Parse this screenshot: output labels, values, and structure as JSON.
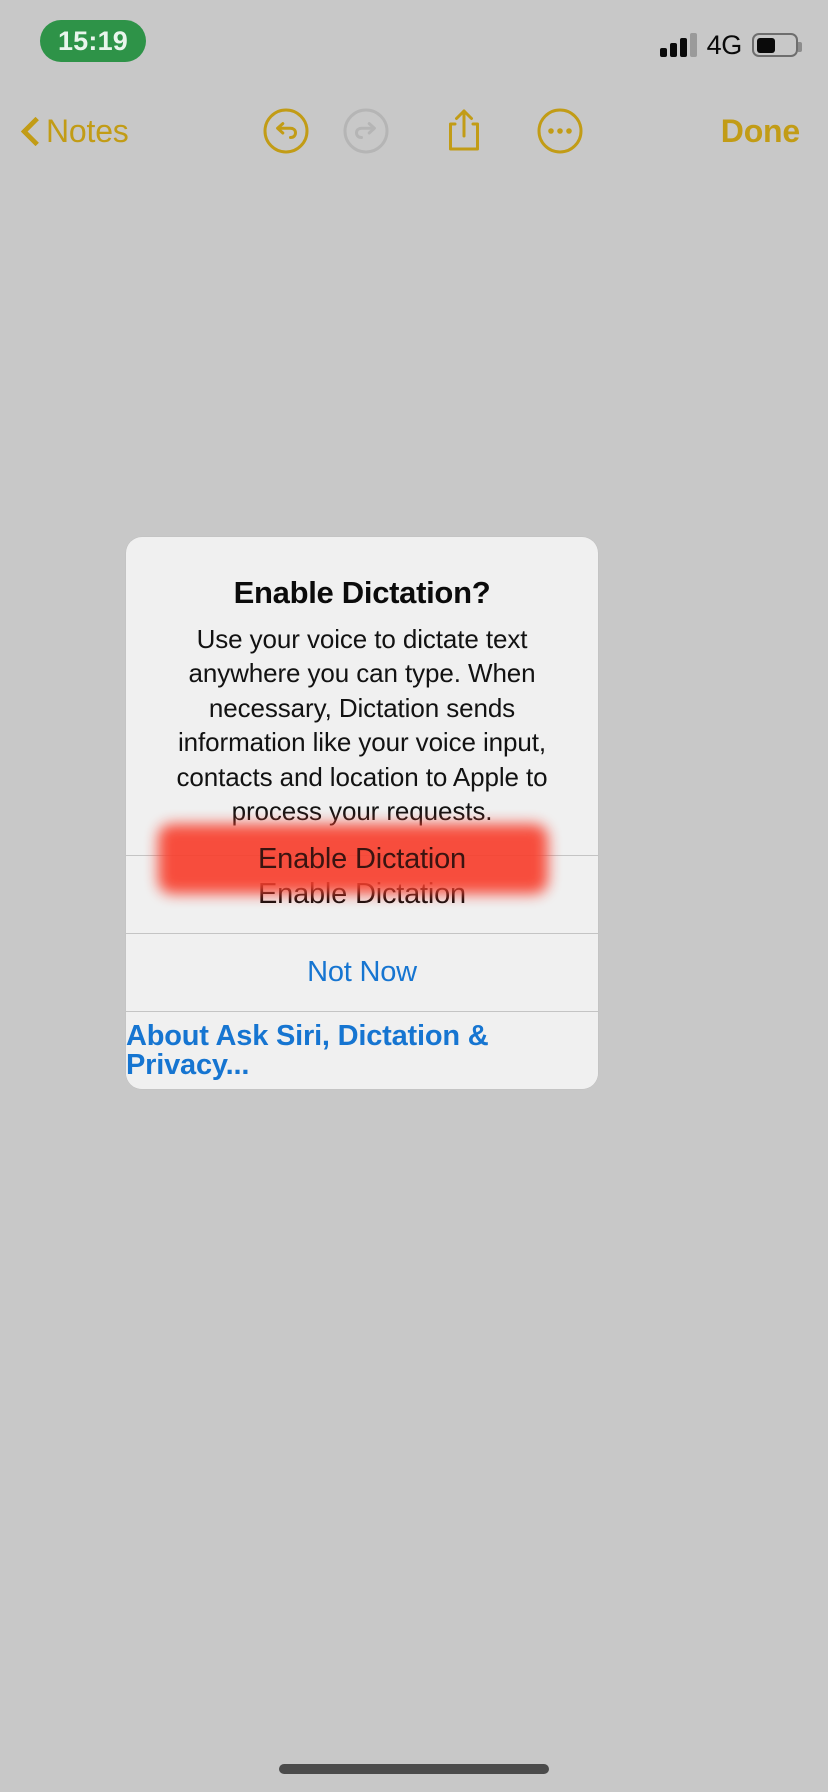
{
  "device": {
    "background_color": "#c8c8c8",
    "home_indicator": "home-indicator"
  },
  "status_bar": {
    "time": "15:19",
    "time_pill_color": "#2e9348",
    "signal_icon": "cellular-signal-icon",
    "signal_bars_filled": 3,
    "signal_bars_total": 4,
    "carrier_network": "4G",
    "battery_icon": "battery-icon",
    "battery_level_percent": 50
  },
  "navbar": {
    "accent_color": "#c29c16",
    "disabled_color": "#b0b0b0",
    "back_label": "Notes",
    "back_icon": "chevron-left-icon",
    "undo_icon": "undo-circle-icon",
    "undo_enabled": true,
    "redo_icon": "redo-circle-icon",
    "redo_enabled": false,
    "share_icon": "share-icon",
    "more_icon": "ellipsis-circle-icon",
    "done_label": "Done"
  },
  "alert": {
    "title": "Enable Dictation?",
    "message": "Use your voice to dictate text anywhere you can type. When necessary, Dictation sends information like your voice input, contacts and location to Apple to process your requests.",
    "actions": [
      {
        "label": "Enable Dictation",
        "style": "default"
      },
      {
        "label": "Not Now",
        "style": "link"
      },
      {
        "label": "About Ask Siri, Dictation & Privacy...",
        "style": "bold-link"
      }
    ]
  },
  "annotation": {
    "highlight_color": "#f8402e",
    "target_label": "Enable Dictation"
  }
}
